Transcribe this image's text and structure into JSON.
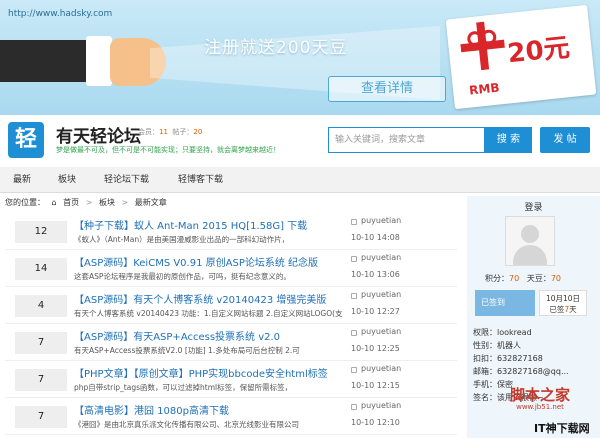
{
  "banner": {
    "url": "http://www.hadsky.com",
    "promo": "注册就送200天豆",
    "detail_button": "查看详情",
    "coupon_amount": "20元",
    "coupon_currency": "RMB"
  },
  "header": {
    "logo_char": "轻",
    "site_name": "有天轻论坛",
    "members_label": "会员：",
    "members_value": "11",
    "posts_label": "帖子：",
    "posts_value": "20",
    "slogan": "梦是做最不可及，但不可是不可能实现；只要坚持，就会离梦越来越近！",
    "search_placeholder": "输入关键词，搜索文章",
    "search_button": "搜 索",
    "post_button": "发 帖"
  },
  "nav": {
    "items": [
      "最新",
      "板块",
      "轻论坛下载",
      "轻博客下载"
    ]
  },
  "breadcrumb": {
    "prefix": "您的位置：",
    "home": "首页",
    "section": "板块",
    "current": "最新文章"
  },
  "threads": [
    {
      "count": "12",
      "title": "【种子下载】蚁人 Ant-Man 2015 HQ[1.58G] 下载",
      "excerpt": "《蚁人》（Ant-Man）是由美国漫威影业出品的一部科幻动作片，",
      "author": "puyuetian",
      "time": "10-10 14:08"
    },
    {
      "count": "14",
      "title": "【ASP源码】KeiCMS V0.91 原创ASP论坛系统 纪念版",
      "excerpt": "这套ASP论坛程序是我最初的原创作品，可吗，挺有纪念意义的。",
      "author": "puyuetian",
      "time": "10-10 13:06"
    },
    {
      "count": "4",
      "title": "【ASP源码】有天个人博客系统 v20140423 增强完美版",
      "excerpt": "有天个人博客系统 v20140423 功能：1.自定义网站标题 2.自定义网站LOGO(支",
      "author": "puyuetian",
      "time": "10-10 12:27"
    },
    {
      "count": "7",
      "title": "【ASP源码】有天ASP+Access投票系统 v2.0",
      "excerpt": "有天ASP+Access投票系统V2.0 [功能] 1.多处布局可后台控制 2.可",
      "author": "puyuetian",
      "time": "10-10 12:25"
    },
    {
      "count": "7",
      "title": "【PHP文章】【原创文章】PHP实现bbcode安全html标签",
      "excerpt": "php自带strip_tags函数，可以过滤掉html标签，保留所需标签，",
      "author": "puyuetian",
      "time": "10-10 12:15"
    },
    {
      "count": "7",
      "title": "【高清电影】港囧 1080p高清下载",
      "excerpt": "《港囧》是由北京真乐派文化传播有限公司、北京光线影业有限公司",
      "author": "puyuetian",
      "time": "10-10 12:10"
    }
  ],
  "sidebar": {
    "login": "登录",
    "points_label": "积分：",
    "points_value": "70",
    "tiandou_label": "天豆：",
    "tiandou_value": "70",
    "signed_button": "已签到",
    "date": "10月10日",
    "signed_days_prefix": "已签",
    "signed_days_value": "7",
    "signed_days_suffix": "天",
    "profile": [
      {
        "label": "权限：",
        "value": "lookread"
      },
      {
        "label": "性别：",
        "value": "机器人"
      },
      {
        "label": "扣扣：",
        "value": "632827168"
      },
      {
        "label": "邮箱：",
        "value": "632827168@qq..."
      },
      {
        "label": "手机：",
        "value": "保密"
      },
      {
        "label": "签名：",
        "value": "该用户很懒~"
      }
    ]
  },
  "watermarks": {
    "jb51": "脚本之家",
    "jb51_url": "www.jb51.net",
    "corner": "IT神下载网"
  }
}
